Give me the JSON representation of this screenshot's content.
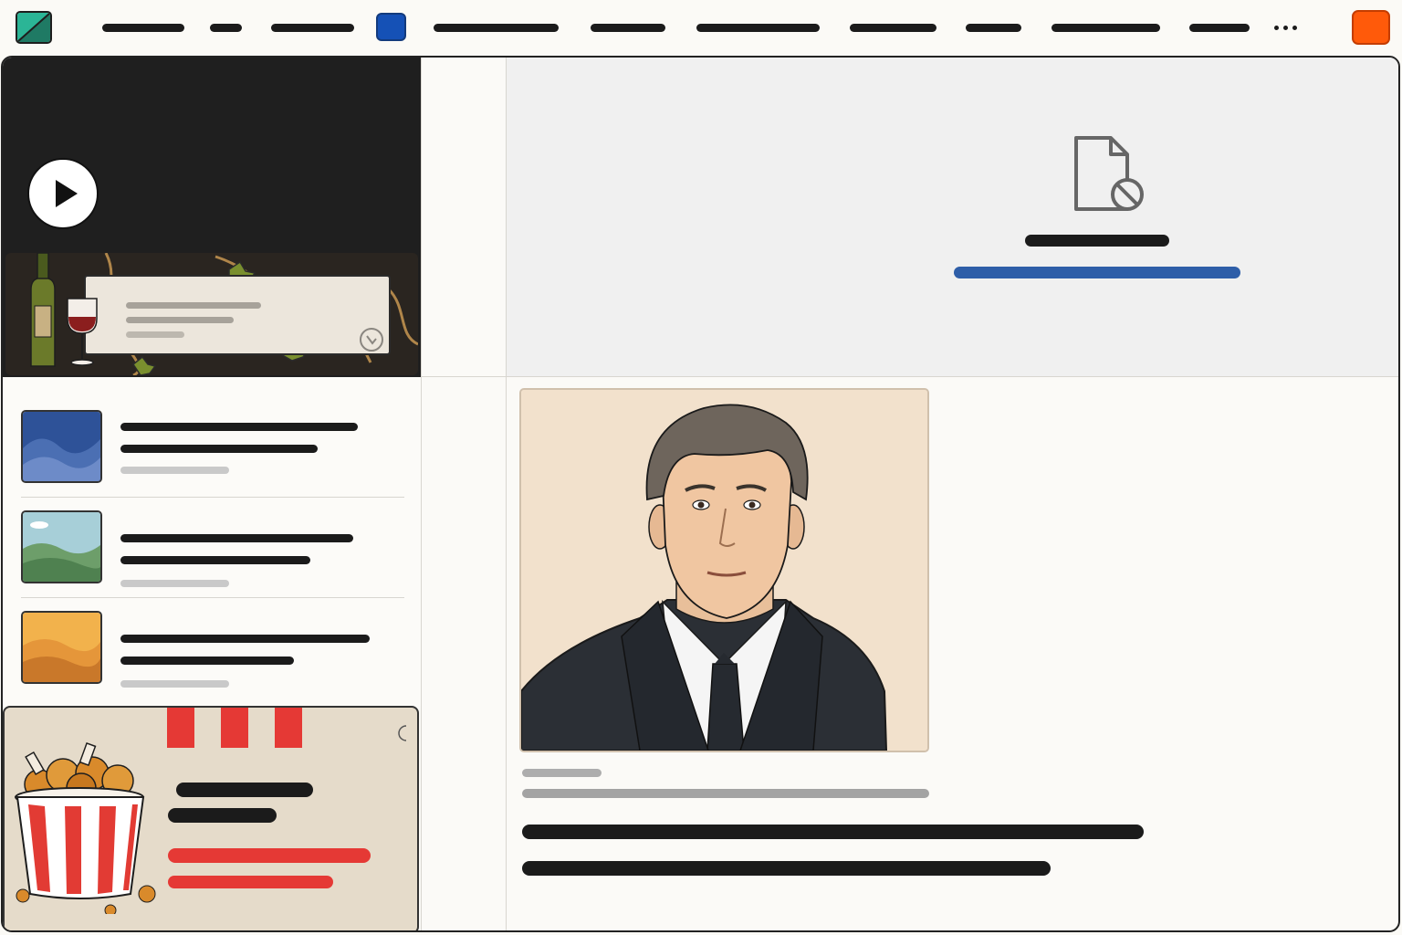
{
  "topnav": {
    "links": [
      "",
      "",
      "",
      "",
      "",
      "",
      "",
      "",
      "",
      ""
    ],
    "more_icon": "more-horizontal-icon",
    "logo_icon": "site-logo-icon",
    "accent_square_color": "#1551b6",
    "action_button_color": "#ff5a0a"
  },
  "sidebar": {
    "video": {
      "icon": "play-icon"
    },
    "wine_ad": {
      "icon": "adchoices-icon"
    },
    "articles": [
      {
        "thumbnail": "blue-waves-thumbnail",
        "title": "",
        "meta": ""
      },
      {
        "thumbnail": "landscape-thumbnail",
        "title": "",
        "meta": ""
      },
      {
        "thumbnail": "orange-dunes-thumbnail",
        "title": "",
        "meta": ""
      }
    ],
    "food_ad": {
      "icon": "fried-chicken-bucket-icon",
      "accent_color": "#e53935"
    }
  },
  "main": {
    "media_error": {
      "icon": "file-blocked-icon",
      "link_color": "#2e5ea8"
    },
    "portrait": {
      "image": "man-in-suit-portrait"
    },
    "caption": {
      "meta": "",
      "credit": "",
      "headline": ""
    }
  }
}
